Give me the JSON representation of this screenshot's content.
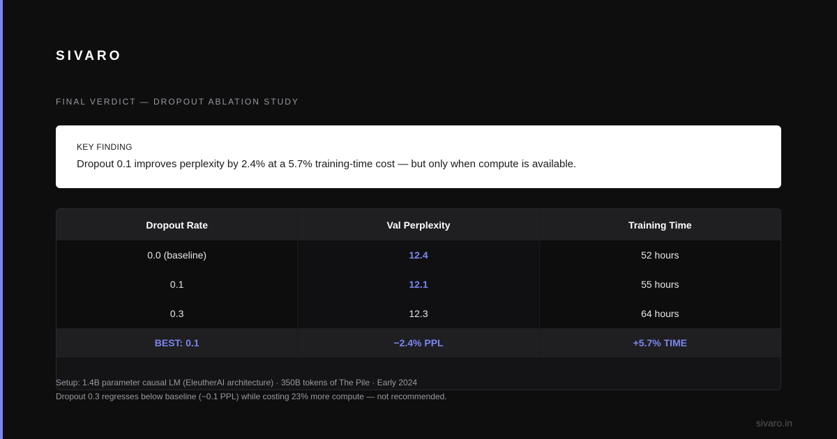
{
  "brand": "SIVARO",
  "eyebrow": "FINAL VERDICT — DROPOUT ABLATION STUDY",
  "finding": {
    "label": "KEY FINDING",
    "text": "Dropout 0.1 improves perplexity by 2.4% at a 5.7% training-time cost — but only when compute is available."
  },
  "table": {
    "headers": [
      "Dropout Rate",
      "Val Perplexity",
      "Training Time"
    ],
    "rows": [
      [
        "0.0 (baseline)",
        "12.4",
        "52 hours"
      ],
      [
        "0.1",
        "12.1",
        "55 hours"
      ],
      [
        "0.3",
        "12.3",
        "64 hours"
      ]
    ],
    "summary": [
      "BEST: 0.1",
      "−2.4% PPL",
      "+5.7% TIME"
    ]
  },
  "notes": {
    "line1": "Setup: 1.4B parameter causal LM (EleutherAI architecture) · 350B tokens of The Pile · Early 2024",
    "line2": "Dropout 0.3 regresses below baseline (−0.1 PPL) while costing 23% more compute — not recommended."
  },
  "footer": {
    "url": "sivaro.in"
  },
  "colors": {
    "accent": "#7b86f0",
    "background": "#0e0e0f"
  }
}
